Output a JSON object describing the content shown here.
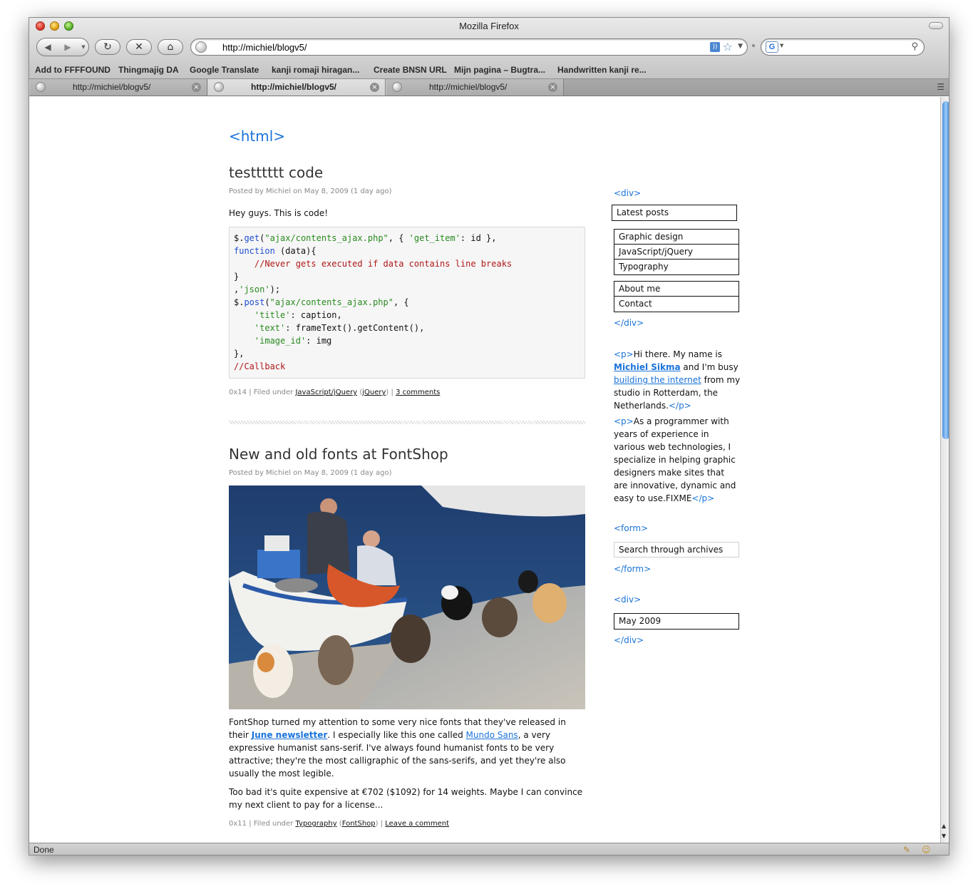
{
  "window": {
    "title": "Mozilla Firefox"
  },
  "toolbar": {
    "url": "http://michiel/blogv5/",
    "back_icon": "back-arrow-icon",
    "forward_icon": "forward-arrow-icon",
    "reload_icon": "reload-icon",
    "stop_icon": "stop-icon",
    "home_icon": "home-icon",
    "search_engine": "G"
  },
  "bookmarks": [
    "Add to FFFFOUND",
    "Thingmajig DA",
    "Google Translate",
    "kanji romaji hiragan...",
    "Create BNSN URL",
    "Mijn pagina – Bugtra...",
    "Handwritten kanji re..."
  ],
  "tabs": [
    {
      "label": "http://michiel/blogv5/",
      "active": false
    },
    {
      "label": "http://michiel/blogv5/",
      "active": true
    },
    {
      "label": "http://michiel/blogv5/",
      "active": false
    }
  ],
  "status": {
    "text": "Done"
  },
  "page": {
    "site_title": "<html>",
    "posts": [
      {
        "title": "testttttt code",
        "meta": "Posted by Michiel on May 8, 2009 (1 day ago)",
        "intro": "Hey guys. This is code!",
        "footer": {
          "id": "0x14",
          "filed_under": "Filed under",
          "category": "JavaScript/jQuery",
          "tag": "jQuery",
          "comments": "3 comments"
        }
      },
      {
        "title": "New and old fonts at FontShop",
        "meta": "Posted by Michiel on May 8, 2009 (1 day ago)",
        "para1_a": "FontShop turned my attention to some very nice fonts that they've released in their ",
        "para1_link1": "June newsletter",
        "para1_b": ". I especially like this one called ",
        "para1_link2": "Mundo Sans",
        "para1_c": ", a very expressive humanist sans-serif. I've always found humanist fonts to be very attractive; they're the most calligraphic of the sans-serifs, and yet they're also usually the most legible.",
        "para2": "Too bad it's quite expensive at €702 ($1092) for 14 weights. Maybe I can convince my next client to pay for a license...",
        "footer": {
          "id": "0x11",
          "filed_under": "Filed under",
          "category": "Typography",
          "tag": "FontShop",
          "comments": "Leave a comment"
        }
      }
    ]
  },
  "sidebar": {
    "div_open": "<div>",
    "div_close": "</div>",
    "latest_posts": "Latest posts",
    "categories": [
      "Graphic design",
      "JavaScript/jQuery",
      "Typography"
    ],
    "pages": [
      "About me",
      "Contact"
    ],
    "p_open": "<p>",
    "p_close": "</p>",
    "bio1_a": "Hi there. My name is ",
    "bio1_link1": "Michiel Sikma",
    "bio1_b": " and I'm busy ",
    "bio1_link2": "building the internet",
    "bio1_c": " from my studio in Rotterdam, the Netherlands.",
    "bio2": "As a programmer with years of experience in various web technologies, I specialize in helping graphic designers make sites that are innovative, dynamic and easy to use.FIXME",
    "form_open": "<form>",
    "form_close": "</form>",
    "search_value": "Search through archives",
    "archive": "May 2009"
  },
  "colors": {
    "link": "#1a73d9",
    "code_string": "#2a8a20",
    "code_keyword": "#1f4fd0",
    "code_comment": "#b01818"
  }
}
